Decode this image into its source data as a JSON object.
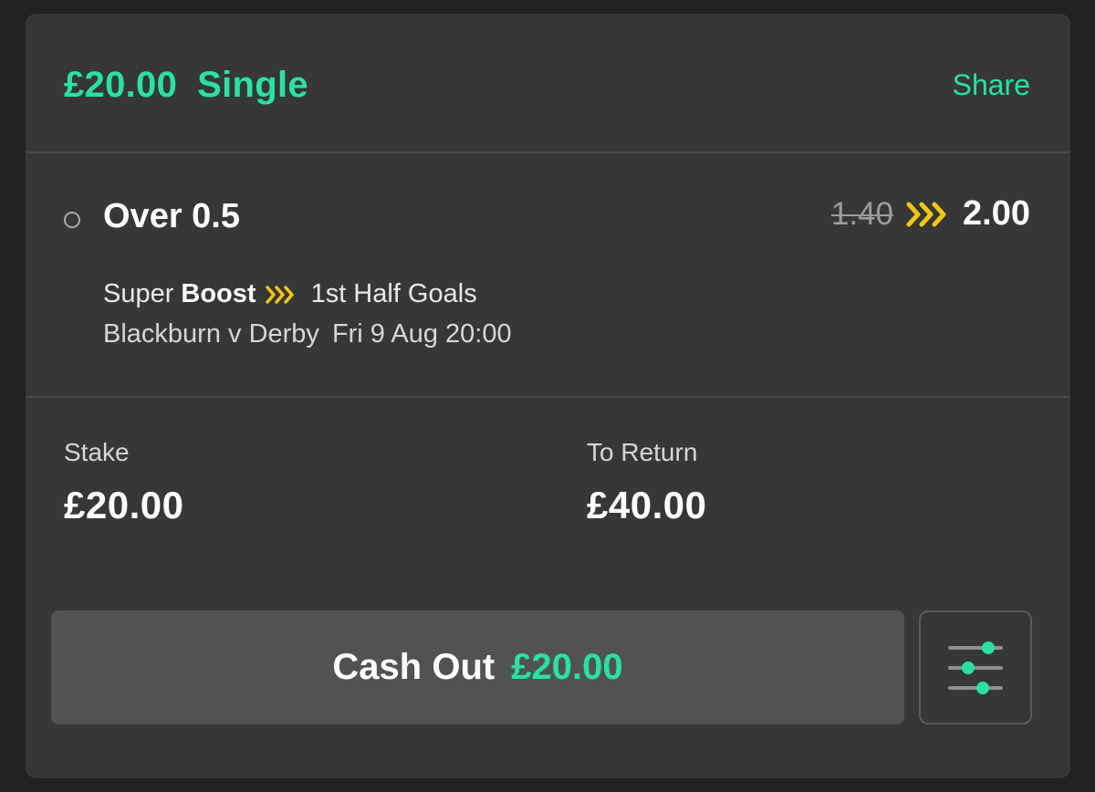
{
  "header": {
    "amount": "£20.00",
    "bet_type": "Single",
    "share_label": "Share"
  },
  "selection": {
    "name": "Over 0.5",
    "odds_old": "1.40",
    "odds_new": "2.00",
    "boost_prefix": "Super",
    "boost_word": "Boost",
    "market": "1st Half Goals",
    "event": "Blackburn v Derby",
    "datetime": "Fri 9 Aug 20:00"
  },
  "stake": {
    "label": "Stake",
    "value": "£20.00"
  },
  "to_return": {
    "label": "To Return",
    "value": "£40.00"
  },
  "cash_out": {
    "label": "Cash Out",
    "amount": "£20.00"
  },
  "icons": {
    "boost": "chevron-triple-icon",
    "settings": "sliders-icon",
    "status": "radio-circle-icon"
  },
  "colors": {
    "accent": "#2ce0a3",
    "boost": "#f5c518",
    "card_bg": "#353836",
    "page_bg": "#202221"
  }
}
